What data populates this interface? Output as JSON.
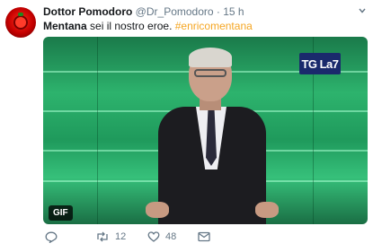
{
  "tweet": {
    "author_name": "Dottor Pomodoro",
    "author_handle": "@Dr_Pomodoro",
    "separator": "·",
    "time": "15 h",
    "text_bold": "Mentana",
    "text_plain": " sei il nostro eroe. ",
    "hashtag": "#enricomentana"
  },
  "media": {
    "logo_text": "TG La7",
    "badge": "GIF"
  },
  "actions": {
    "retweet_count": "12",
    "like_count": "48"
  },
  "colors": {
    "accent": "#f5a623",
    "secondary_text": "#657786"
  },
  "icons": [
    "chevron-down-icon",
    "reply-icon",
    "retweet-icon",
    "like-icon",
    "direct-message-icon"
  ]
}
